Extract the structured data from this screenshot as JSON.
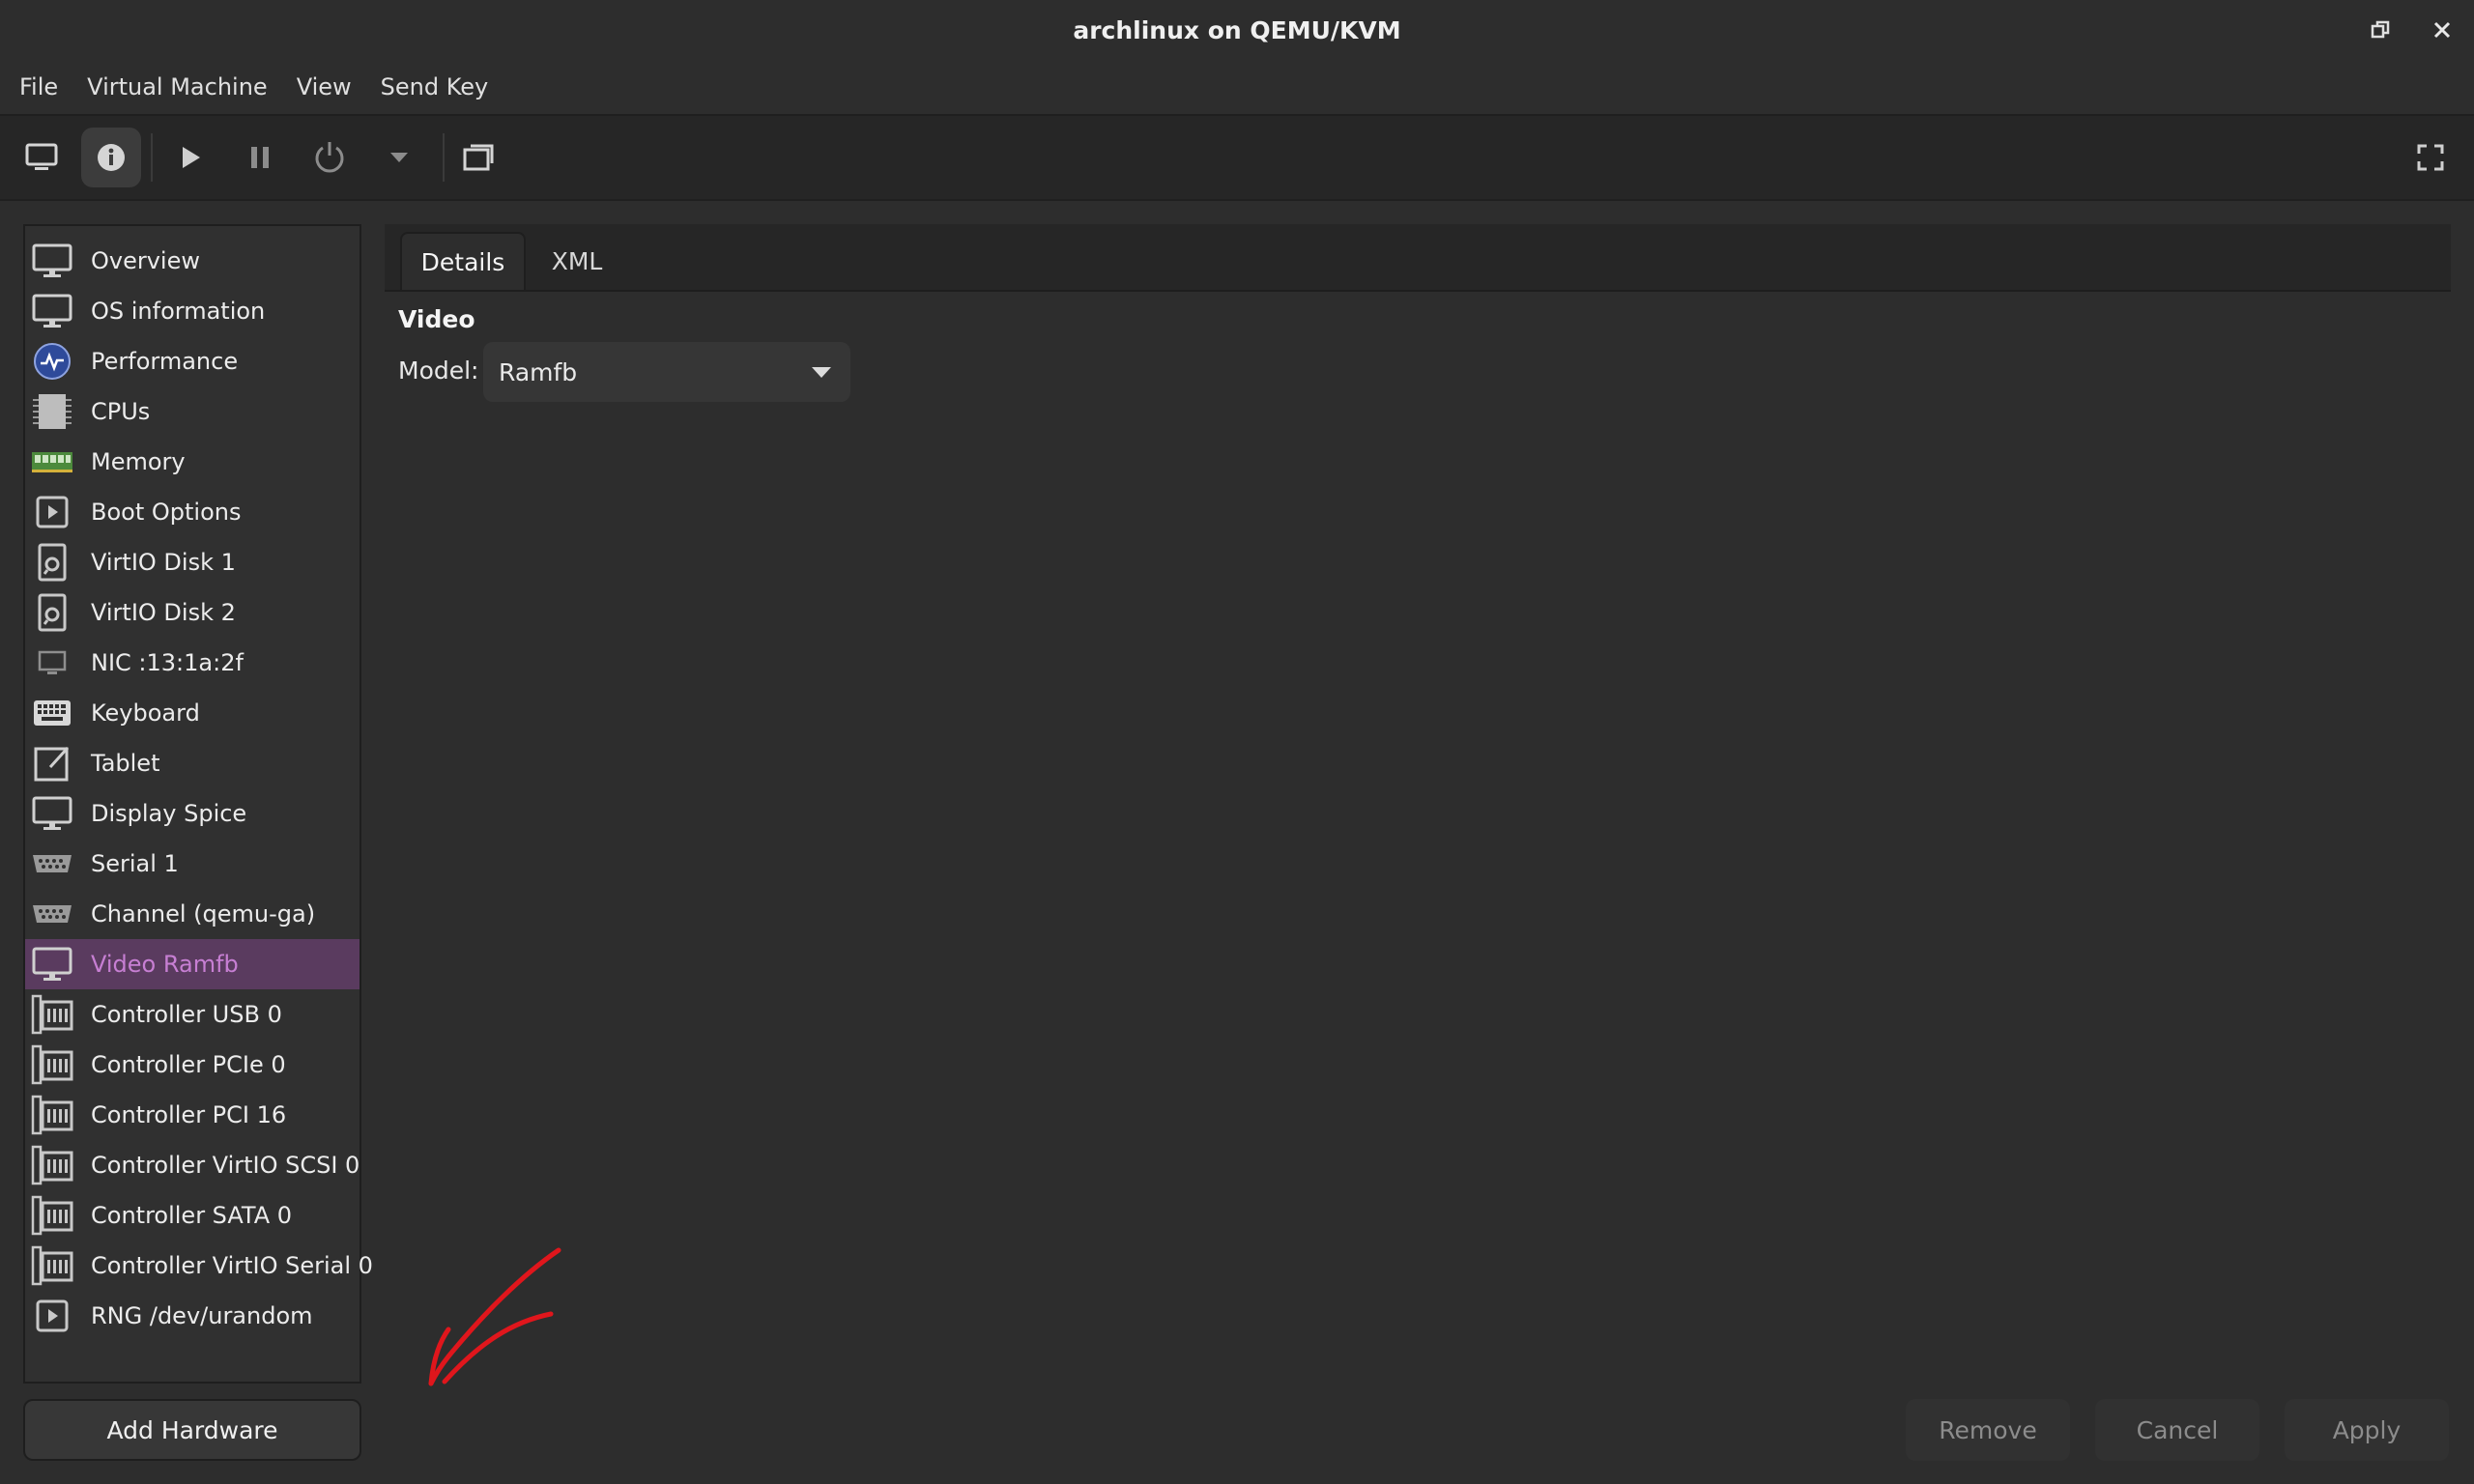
{
  "window": {
    "title": "archlinux on QEMU/KVM"
  },
  "menubar": {
    "items": [
      "File",
      "Virtual Machine",
      "View",
      "Send Key"
    ]
  },
  "toolbar": {
    "icons": [
      "monitor-icon",
      "info-icon",
      "play-icon",
      "pause-icon",
      "power-icon",
      "chevron-down-icon",
      "screenshot-icon",
      "fullscreen-icon"
    ]
  },
  "sidebar": {
    "items": [
      {
        "label": "Overview",
        "icon": "monitor-icon"
      },
      {
        "label": "OS information",
        "icon": "monitor-icon"
      },
      {
        "label": "Performance",
        "icon": "performance-icon"
      },
      {
        "label": "CPUs",
        "icon": "cpu-icon"
      },
      {
        "label": "Memory",
        "icon": "memory-icon"
      },
      {
        "label": "Boot Options",
        "icon": "boot-icon"
      },
      {
        "label": "VirtIO Disk 1",
        "icon": "disk-icon"
      },
      {
        "label": "VirtIO Disk 2",
        "icon": "disk-icon"
      },
      {
        "label": "NIC :13:1a:2f",
        "icon": "nic-icon"
      },
      {
        "label": "Keyboard",
        "icon": "keyboard-icon"
      },
      {
        "label": "Tablet",
        "icon": "tablet-icon"
      },
      {
        "label": "Display Spice",
        "icon": "monitor-icon"
      },
      {
        "label": "Serial 1",
        "icon": "serial-icon"
      },
      {
        "label": "Channel (qemu-ga)",
        "icon": "serial-icon"
      },
      {
        "label": "Video Ramfb",
        "icon": "monitor-icon",
        "selected": true
      },
      {
        "label": "Controller USB 0",
        "icon": "controller-icon"
      },
      {
        "label": "Controller PCIe 0",
        "icon": "controller-icon"
      },
      {
        "label": "Controller PCI 16",
        "icon": "controller-icon"
      },
      {
        "label": "Controller VirtIO SCSI 0",
        "icon": "controller-icon"
      },
      {
        "label": "Controller SATA 0",
        "icon": "controller-icon"
      },
      {
        "label": "Controller VirtIO Serial 0",
        "icon": "controller-icon"
      },
      {
        "label": "RNG /dev/urandom",
        "icon": "boot-icon"
      }
    ],
    "add_hardware_label": "Add Hardware"
  },
  "tabs": [
    {
      "label": "Details",
      "active": true
    },
    {
      "label": "XML",
      "active": false
    }
  ],
  "details": {
    "section_title": "Video",
    "model_label": "Model:",
    "model_value": "Ramfb"
  },
  "buttons": {
    "remove": "Remove",
    "cancel": "Cancel",
    "apply": "Apply"
  },
  "colors": {
    "selection": "#5a3b5f",
    "selection_text": "#c77fd3",
    "annotation": "#e0161c"
  }
}
